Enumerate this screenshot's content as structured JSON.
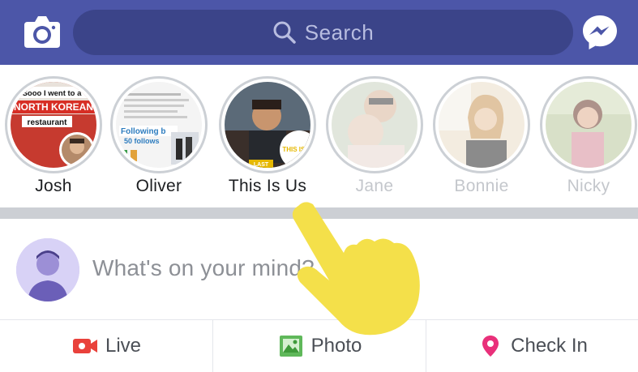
{
  "topbar": {
    "background": "#4c56a8",
    "camera_icon": "camera-icon",
    "search_icon": "search-icon",
    "search_placeholder": "Search",
    "messenger_icon": "messenger-icon"
  },
  "stories": [
    {
      "name": "Josh",
      "seen": false,
      "overlay_lines": [
        "Sooo I went to a",
        "NORTH KOREAN",
        "restaurant"
      ]
    },
    {
      "name": "Oliver",
      "seen": false,
      "overlay_lines": [
        "Following b",
        "50 follows"
      ]
    },
    {
      "name": "This Is Us",
      "seen": false,
      "overlay_lines": [
        "THIS IS US",
        "LAST"
      ]
    },
    {
      "name": "Jane",
      "seen": true
    },
    {
      "name": "Bonnie",
      "seen": true
    },
    {
      "name": "Nicky",
      "seen": true
    }
  ],
  "composer": {
    "prompt": "What's on your mind?"
  },
  "actions": [
    {
      "label": "Live",
      "icon": "live-video-icon",
      "color": "#e9413b"
    },
    {
      "label": "Photo",
      "icon": "photo-icon",
      "color": "#5fb85a"
    },
    {
      "label": "Check In",
      "icon": "location-pin-icon",
      "color": "#e9307a"
    }
  ],
  "colors": {
    "story_ring": "#ccd0d5",
    "divider": "#cccfd4",
    "hand": "#f4e04a"
  }
}
